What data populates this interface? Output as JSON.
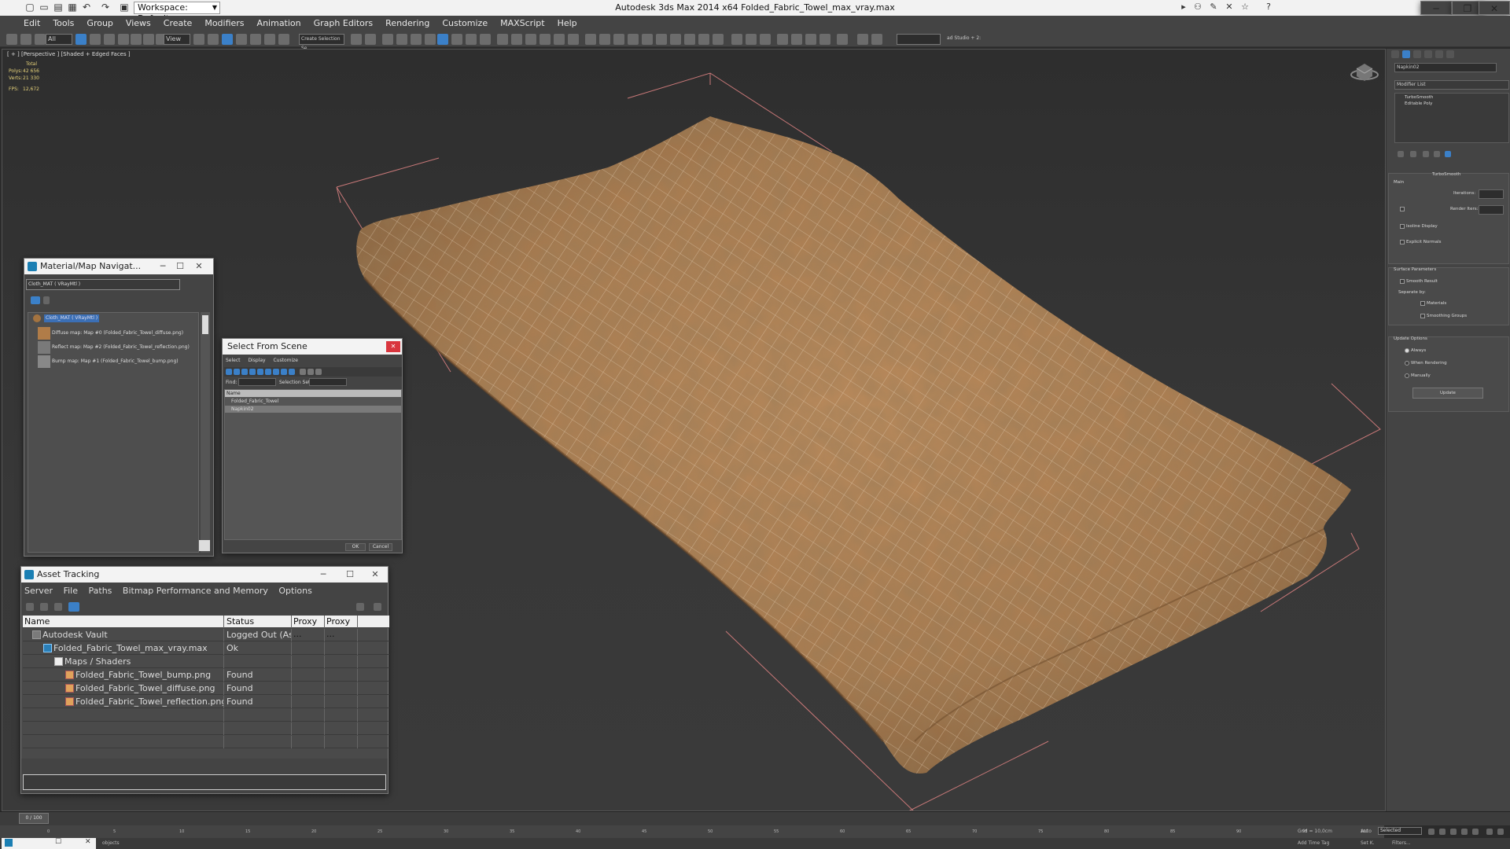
{
  "titlebar": {
    "workspace": "Workspace: Default",
    "title": "Autodesk 3ds Max  2014 x64     Folded_Fabric_Towel_max_vray.max"
  },
  "menu": [
    "Edit",
    "Tools",
    "Group",
    "Views",
    "Create",
    "Modifiers",
    "Animation",
    "Graph Editors",
    "Rendering",
    "Customize",
    "MAXScript",
    "Help"
  ],
  "toolbar": {
    "selection_filter": "All",
    "ref_coord": "View",
    "named_selection": "Create Selection Se",
    "studio": "ad Studio + 2:"
  },
  "viewport": {
    "label": "[ + ] [Perspective ] [Shaded + Edged Faces ]",
    "stats": {
      "total_label": "Total",
      "polys_label": "Polys:",
      "polys": "42 656",
      "verts_label": "Verts:",
      "verts": "21 330",
      "fps_label": "FPS:",
      "fps": "12,672"
    }
  },
  "material_navigator": {
    "title": "Material/Map Navigat...",
    "field": "Cloth_MAT ( VRayMtl )",
    "items": [
      "Cloth_MAT ( VRayMtl )",
      "Diffuse map: Map #0 (Folded_Fabric_Towel_diffuse.png)",
      "Reflect map: Map #2 (Folded_Fabric_Towel_reflection.png)",
      "Bump map: Map #1 (Folded_Fabric_Towel_bump.png)"
    ]
  },
  "select_from_scene": {
    "title": "Select From Scene",
    "menu": [
      "Select",
      "Display",
      "Customize"
    ],
    "find_label": "Find:",
    "selection_set_label": "Selection Set:",
    "column": "Name",
    "rows": [
      "Folded_Fabric_Towel",
      "Napkin02"
    ],
    "ok": "OK",
    "cancel": "Cancel"
  },
  "asset_tracking": {
    "title": "Asset Tracking",
    "menu": [
      "Server",
      "File",
      "Paths",
      "Bitmap Performance and Memory",
      "Options"
    ],
    "headers": [
      "Name",
      "Status",
      "Proxy ...",
      "Proxy ..."
    ],
    "rows": [
      {
        "name": "Autodesk Vault",
        "status": "Logged Out (As..."
      },
      {
        "name": "Folded_Fabric_Towel_max_vray.max",
        "status": "Ok"
      },
      {
        "name": "Maps / Shaders",
        "status": ""
      },
      {
        "name": "Folded_Fabric_Towel_bump.png",
        "status": "Found"
      },
      {
        "name": "Folded_Fabric_Towel_diffuse.png",
        "status": "Found"
      },
      {
        "name": "Folded_Fabric_Towel_reflection.png",
        "status": "Found"
      }
    ]
  },
  "command_panel": {
    "object_name": "Napkin02",
    "modifier_list": "Modifier List",
    "stack": [
      "TurboSmooth",
      "Editable Poly"
    ],
    "rollout_title": "TurboSmooth",
    "main_label": "Main",
    "iterations_label": "Iterations:",
    "render_iters_label": "Render Iters:",
    "isoline_label": "Isoline Display",
    "explicit_label": "Explicit Normals",
    "surface_label": "Surface Parameters",
    "smooth_label": "Smooth Result",
    "separate_label": "Separate by:",
    "materials_label": "Materials",
    "smoothing_label": "Smoothing Groups",
    "update_options_label": "Update Options",
    "always_label": "Always",
    "when_rendering_label": "When Rendering",
    "manually_label": "Manually",
    "update_button": "Update"
  },
  "timeline": {
    "frame": "0 / 100",
    "ticks": [
      "0",
      "5",
      "10",
      "15",
      "20",
      "25",
      "30",
      "35",
      "40",
      "45",
      "50",
      "55",
      "60",
      "65",
      "70",
      "75",
      "80",
      "85",
      "90",
      "95",
      "100"
    ]
  },
  "status": {
    "objects": "objects",
    "grid": "Grid = 10,0cm",
    "auto": "Auto",
    "selected": "Selected",
    "set_k": "Set K.",
    "filters": "Filters...",
    "add_time_tag": "Add Time Tag"
  }
}
